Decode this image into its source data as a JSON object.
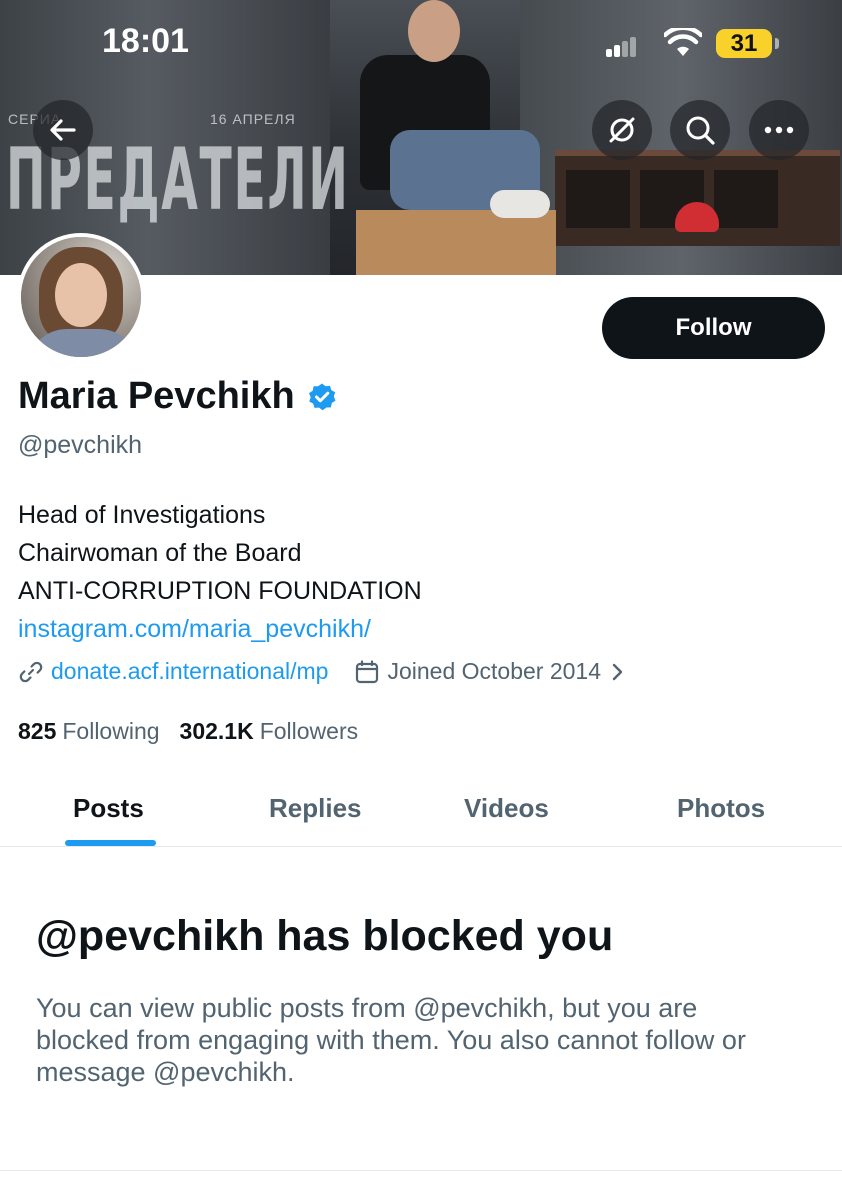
{
  "status_bar": {
    "time": "18:01",
    "battery": "31"
  },
  "banner": {
    "series_label": "СЕРИА",
    "date_label": "16 АПРЕЛЯ",
    "title": "ПРЕДАТЕЛИ"
  },
  "toolbar": {
    "back_icon": "arrow-left-icon",
    "grok_icon": "slashed-circle-icon",
    "search_icon": "search-icon",
    "more_icon": "more-horizontal-icon"
  },
  "profile": {
    "name": "Maria Pevchikh",
    "handle": "@pevchikh",
    "follow_label": "Follow",
    "bio_lines": [
      "Head of Investigations",
      "Chairwoman of the Board",
      "ANTI-CORRUPTION FOUNDATION"
    ],
    "bio_link": "instagram.com/maria_pevchikh/",
    "website": "donate.acf.international/mp",
    "joined": "Joined October 2014",
    "following_count": "825",
    "following_label": "Following",
    "followers_count": "302.1K",
    "followers_label": "Followers"
  },
  "tabs": [
    {
      "label": "Posts",
      "active": true
    },
    {
      "label": "Replies",
      "active": false
    },
    {
      "label": "Videos",
      "active": false
    },
    {
      "label": "Photos",
      "active": false
    }
  ],
  "blocked": {
    "title": "@pevchikh has blocked you",
    "lines": [
      "You can view public posts from @pevchikh, but you are",
      "blocked from engaging with them. You also cannot follow or",
      "message @pevchikh."
    ]
  },
  "colors": {
    "accent": "#1d9bf0",
    "primary_text": "#0f1419",
    "secondary_text": "#536471",
    "battery": "#f8d12b"
  }
}
